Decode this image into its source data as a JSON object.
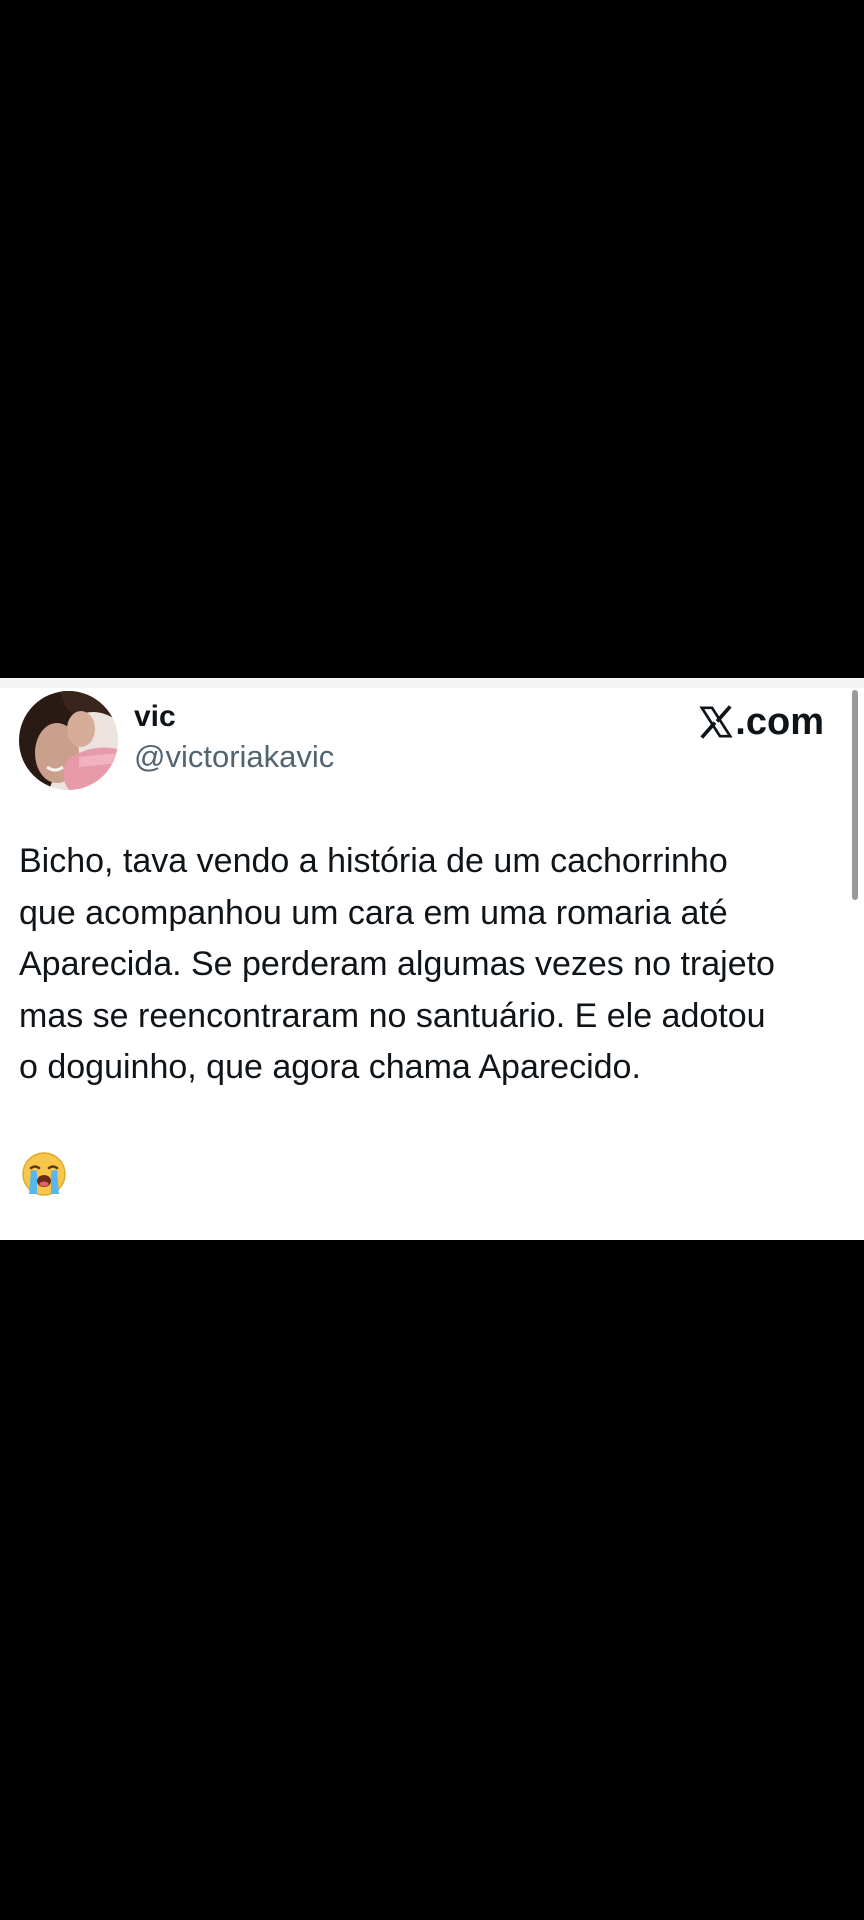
{
  "tweet": {
    "display_name": "vic",
    "handle": "@victoriakavic",
    "brand_label": ".com",
    "brand_icon": "x-logo-icon",
    "lines": [
      "Bicho, tava vendo a história de um cachorrinho",
      "que acompanhou um cara em uma romaria até",
      "Aparecida. Se perderam algumas vezes no trajeto",
      "mas se reencontraram no santuário. E ele adotou",
      "o doguinho, que agora chama Aparecido."
    ],
    "emoji": "loudly-crying-face-icon"
  },
  "colors": {
    "background": "#000000",
    "card": "#ffffff",
    "text": "#0f1419",
    "handle": "#536471"
  }
}
